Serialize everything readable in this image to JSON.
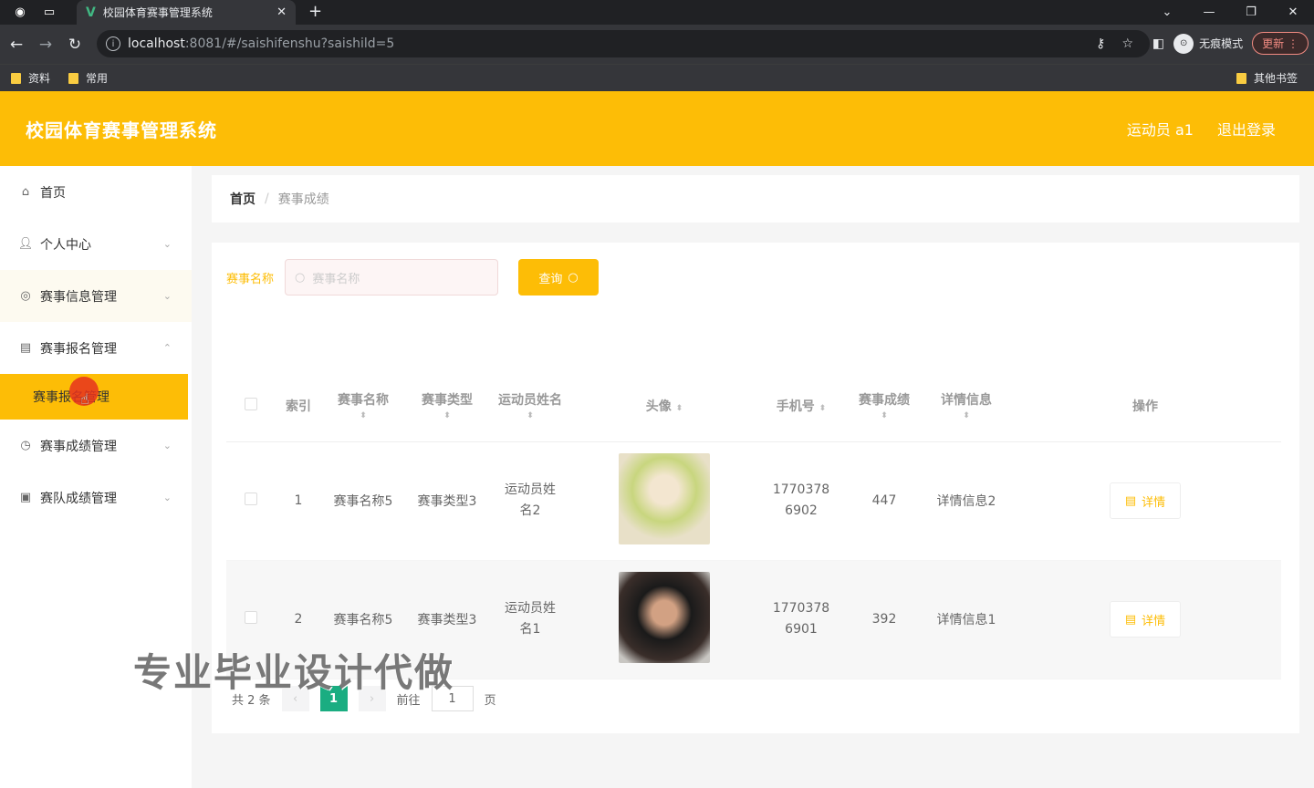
{
  "browser": {
    "tab_title": "校园体育赛事管理系统",
    "url_host": "localhost",
    "url_path": ":8081/#/saishifenshu?saishild=5",
    "incognito_label": "无痕模式",
    "update_label": "更新",
    "bookmarks": [
      "资料",
      "常用"
    ],
    "bookmarks_other": "其他书签"
  },
  "header": {
    "app_title": "校园体育赛事管理系统",
    "user_label": "运动员 a1",
    "logout_label": "退出登录"
  },
  "sidebar": {
    "items": [
      {
        "label": "首页",
        "icon": "home-icon"
      },
      {
        "label": "个人中心",
        "icon": "user-icon"
      },
      {
        "label": "赛事信息管理",
        "icon": "compass-icon"
      },
      {
        "label": "赛事报名管理",
        "icon": "clipboard-icon"
      },
      {
        "label": "赛事成绩管理",
        "icon": "clock-icon"
      },
      {
        "label": "赛队成绩管理",
        "icon": "calendar-x-icon"
      }
    ],
    "active_sub": "赛事报名管理"
  },
  "breadcrumb": {
    "home": "首页",
    "current": "赛事成绩"
  },
  "search": {
    "label": "赛事名称",
    "placeholder": "赛事名称",
    "button": "查询"
  },
  "table": {
    "headers": {
      "index": "索引",
      "name": "赛事名称",
      "type": "赛事类型",
      "athlete": "运动员姓名",
      "avatar": "头像",
      "phone": "手机号",
      "score": "赛事成绩",
      "detail": "详情信息",
      "ops": "操作"
    },
    "rows": [
      {
        "index": "1",
        "name": "赛事名称5",
        "type": "赛事类型3",
        "athlete": "运动员姓名2",
        "phone": "17703786902",
        "score": "447",
        "detail": "详情信息2",
        "action": "详情"
      },
      {
        "index": "2",
        "name": "赛事名称5",
        "type": "赛事类型3",
        "athlete": "运动员姓名1",
        "phone": "17703786901",
        "score": "392",
        "detail": "详情信息1",
        "action": "详情"
      }
    ]
  },
  "pager": {
    "total": "共 2 条",
    "current": "1",
    "goto": "前往",
    "page_input": "1",
    "page_unit": "页"
  },
  "watermark": "专业毕业设计代做"
}
